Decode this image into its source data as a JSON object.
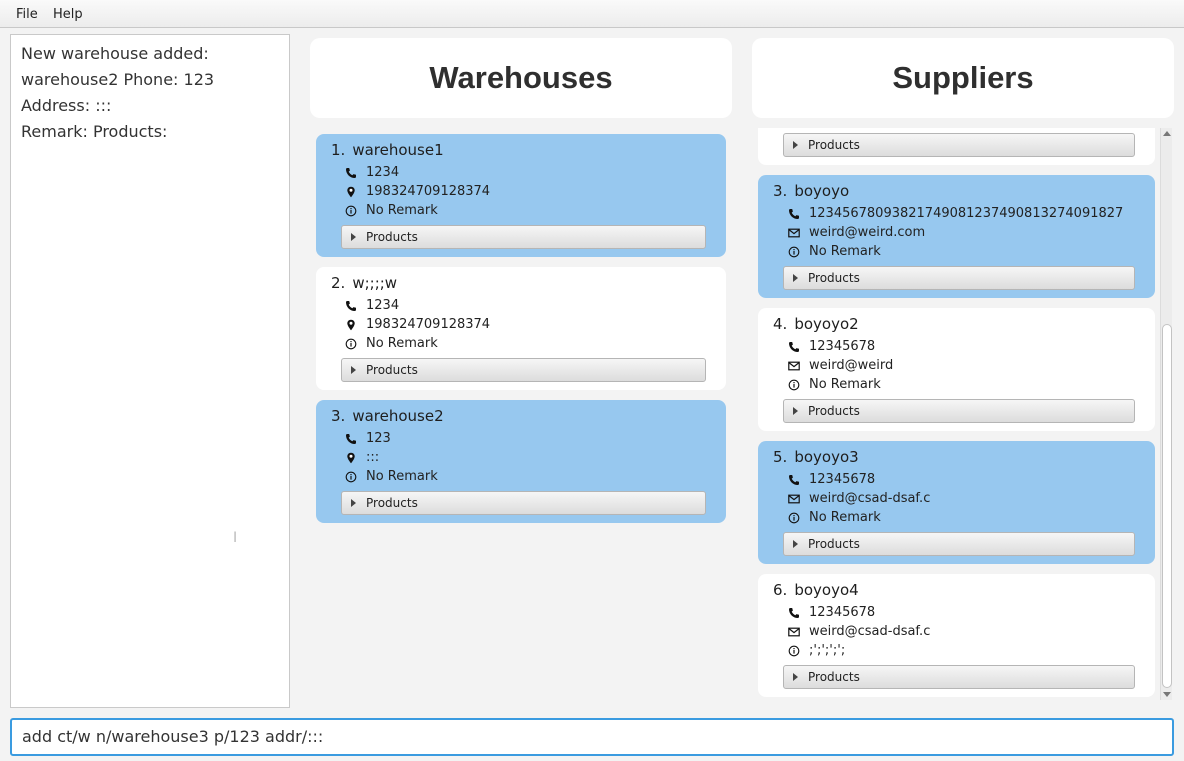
{
  "menu": {
    "file": "File",
    "help": "Help"
  },
  "result": {
    "text": "New warehouse added:\nwarehouse2 Phone: 123 Address: :::\nRemark:  Products:"
  },
  "warehouses": {
    "header": "Warehouses",
    "items": [
      {
        "index": "1.",
        "name": "warehouse1",
        "phone": "1234",
        "address": "198324709128374",
        "remark": "No Remark",
        "products_label": "Products"
      },
      {
        "index": "2.",
        "name": "w;;;;w",
        "phone": "1234",
        "address": "198324709128374",
        "remark": "No Remark",
        "products_label": "Products"
      },
      {
        "index": "3.",
        "name": "warehouse2",
        "phone": "123",
        "address": ":::",
        "remark": "No Remark",
        "products_label": "Products"
      }
    ]
  },
  "suppliers": {
    "header": "Suppliers",
    "partial_products_label": "Products",
    "items": [
      {
        "index": "3.",
        "name": "boyoyo",
        "phone": "12345678093821749081237490813274091827",
        "email": "weird@weird.com",
        "remark": "No Remark",
        "products_label": "Products"
      },
      {
        "index": "4.",
        "name": "boyoyo2",
        "phone": "12345678",
        "email": "weird@weird",
        "remark": "No Remark",
        "products_label": "Products"
      },
      {
        "index": "5.",
        "name": "boyoyo3",
        "phone": "12345678",
        "email": "weird@csad-dsaf.c",
        "remark": "No Remark",
        "products_label": "Products"
      },
      {
        "index": "6.",
        "name": "boyoyo4",
        "phone": "12345678",
        "email": "weird@csad-dsaf.c",
        "remark": ";';';';';",
        "products_label": "Products"
      }
    ]
  },
  "command": {
    "value": "add ct/w n/warehouse3 p/123 addr/:::"
  },
  "icons": {
    "phone": "phone-icon",
    "address": "location-pin-icon",
    "email": "mail-icon",
    "remark": "info-icon",
    "expand": "triangle-right-icon"
  },
  "colors": {
    "selected_card": "#97c8ef",
    "card": "#ffffff",
    "command_border": "#3a9be0"
  }
}
